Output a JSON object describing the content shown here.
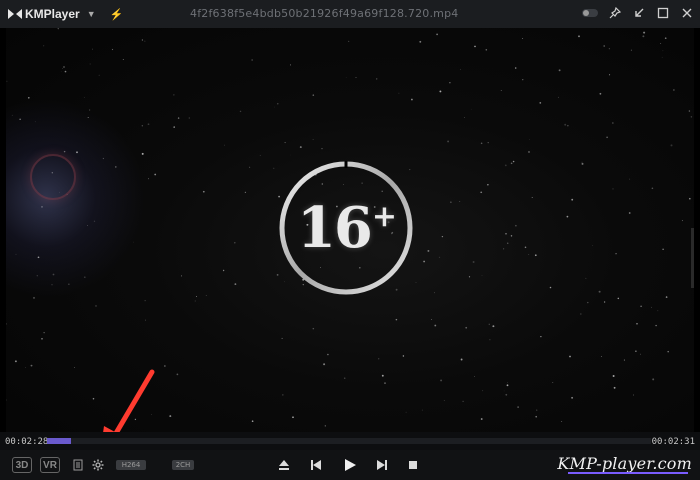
{
  "app": {
    "name": "KMPlayer",
    "file_title": "4f2f638f5e4bdb50b21926f49a69f128.720.mp4"
  },
  "video": {
    "overlay_rating": "16",
    "overlay_rating_plus": "+"
  },
  "playback": {
    "elapsed": "00:02:28",
    "total": "00:02:31",
    "progress": 0.04
  },
  "controls": {
    "badge_3d": "3D",
    "badge_vr": "VR",
    "codec": "H264",
    "channels": "2CH"
  },
  "watermark": "KMP-player.com",
  "colors": {
    "accent": "#6a5acd",
    "annotation": "#ff3b2f"
  },
  "icons": {
    "logo": "kmplayer-logo-icon",
    "menu": "chevron-down-icon",
    "bolt": "bolt-icon",
    "pin": "pin-icon",
    "minimize_to_corner": "arrow-down-left-icon",
    "maximize": "maximize-icon",
    "close": "close-icon",
    "playlist": "playlist-icon",
    "settings": "gear-icon",
    "eject": "eject-icon",
    "previous": "skip-previous-icon",
    "play": "play-icon",
    "next": "skip-next-icon",
    "stop": "stop-icon"
  }
}
